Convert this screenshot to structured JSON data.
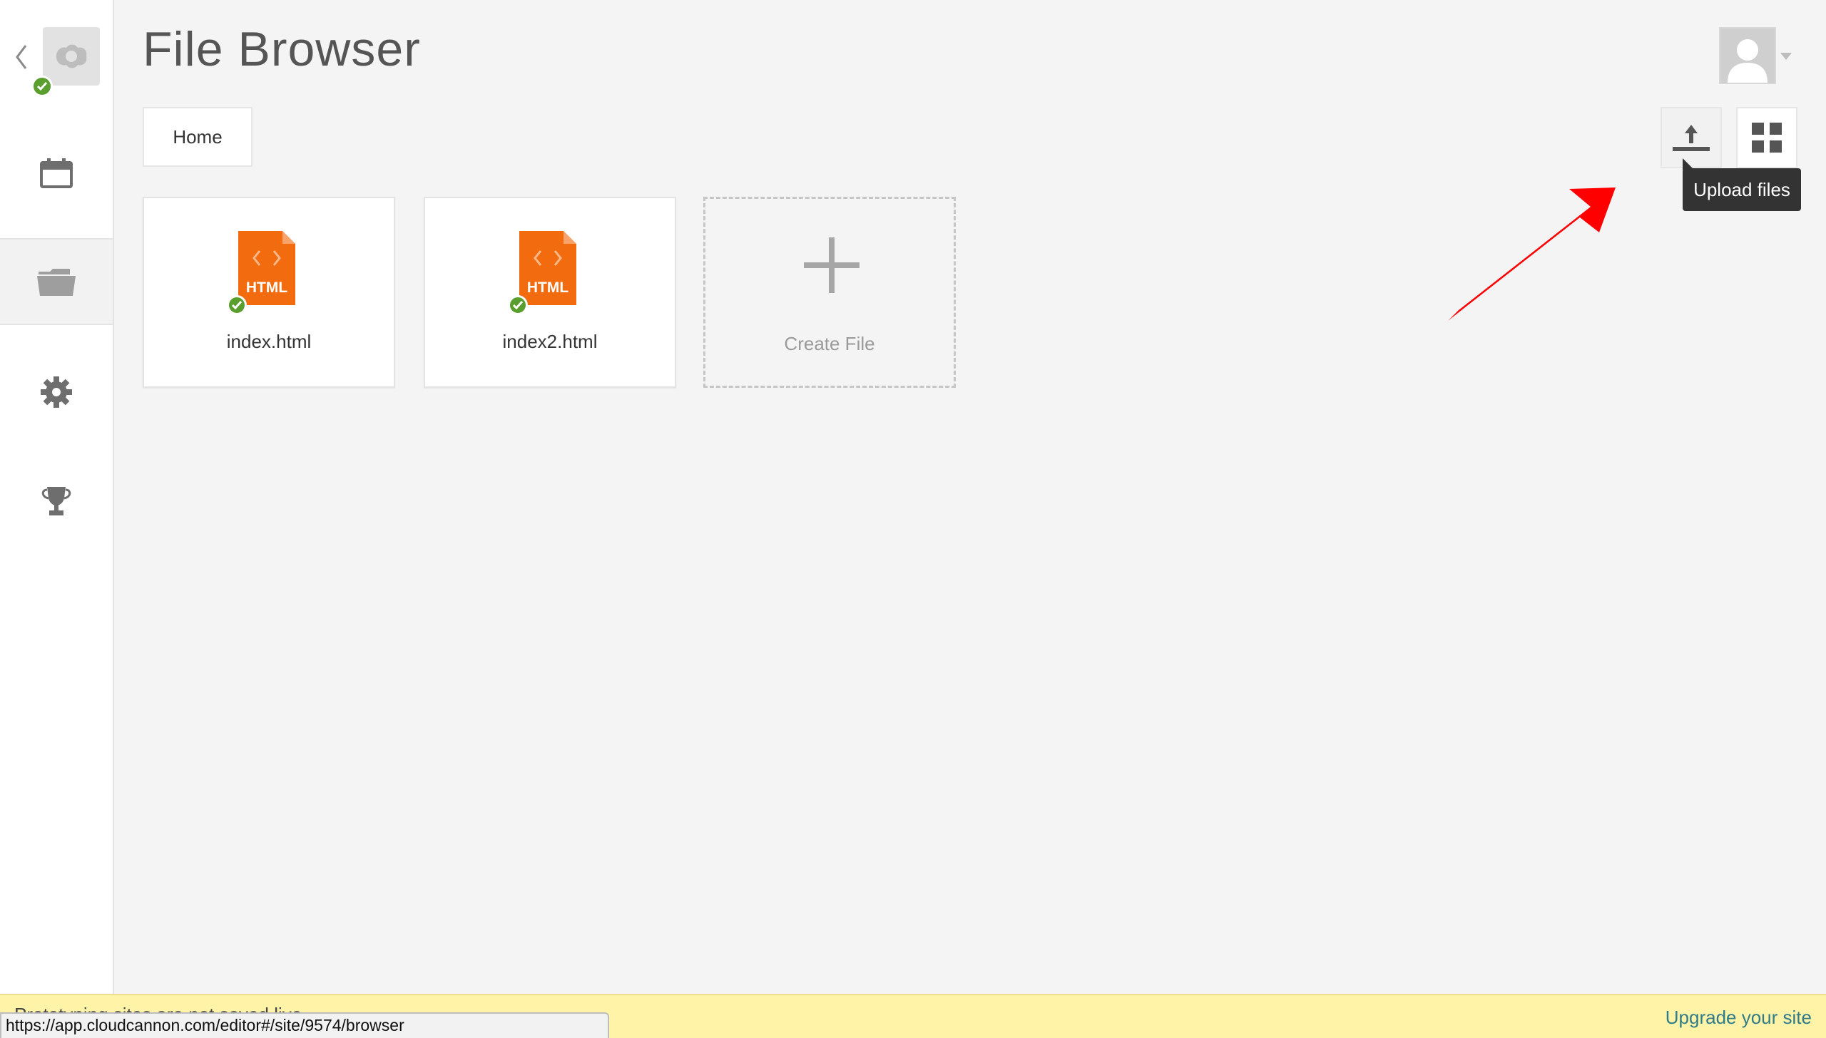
{
  "page": {
    "title": "File Browser"
  },
  "breadcrumb": {
    "home_label": "Home"
  },
  "toolbar": {
    "upload_tooltip": "Upload files"
  },
  "files": [
    {
      "name": "index.html",
      "badge": "HTML"
    },
    {
      "name": "index2.html",
      "badge": "HTML"
    }
  ],
  "create": {
    "label": "Create File"
  },
  "sidebar": {
    "items": [
      {
        "icon": "calendar-icon"
      },
      {
        "icon": "folder-icon",
        "active": true
      },
      {
        "icon": "gear-icon"
      },
      {
        "icon": "trophy-icon"
      }
    ]
  },
  "bottom_bar": {
    "message": "Prototyping sites are not saved live",
    "upgrade_link": "Upgrade your site"
  },
  "status": {
    "url": "https://app.cloudcannon.com/editor#/site/9574/browser"
  },
  "colors": {
    "html_file": "#f26b0f",
    "check": "#5a9e2e",
    "annotation_arrow": "#ff0000",
    "banner": "#fff3a8",
    "link": "#2f7b87"
  }
}
